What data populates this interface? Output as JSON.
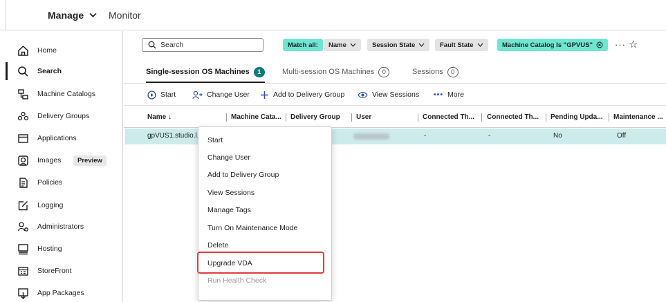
{
  "top_nav": {
    "manage": "Manage",
    "monitor": "Monitor"
  },
  "sidebar": {
    "items": [
      {
        "label": "Home",
        "icon": "home-icon"
      },
      {
        "label": "Search",
        "icon": "search-icon"
      },
      {
        "label": "Machine Catalogs",
        "icon": "machine-catalogs-icon"
      },
      {
        "label": "Delivery Groups",
        "icon": "delivery-groups-icon"
      },
      {
        "label": "Applications",
        "icon": "applications-icon"
      },
      {
        "label": "Images",
        "icon": "images-icon",
        "badge": "Preview"
      },
      {
        "label": "Policies",
        "icon": "policies-icon"
      },
      {
        "label": "Logging",
        "icon": "logging-icon"
      },
      {
        "label": "Administrators",
        "icon": "administrators-icon"
      },
      {
        "label": "Hosting",
        "icon": "hosting-icon"
      },
      {
        "label": "StoreFront",
        "icon": "storefront-icon"
      },
      {
        "label": "App Packages",
        "icon": "app-packages-icon"
      }
    ],
    "active": "Search"
  },
  "filters": {
    "search_placeholder": "Search",
    "match_all": "Match all:",
    "name": "Name",
    "session_state": "Session State",
    "fault_state": "Fault State",
    "machine_catalog": "Machine Catalog Is \"GPVUS\""
  },
  "tabs": [
    {
      "label": "Single-session OS Machines",
      "count": "1"
    },
    {
      "label": "Multi-session OS Machines",
      "count": "0"
    },
    {
      "label": "Sessions",
      "count": "0"
    }
  ],
  "actions": {
    "start": "Start",
    "change_user": "Change User",
    "add_to_delivery_group": "Add to Delivery Group",
    "view_sessions": "View Sessions",
    "more": "More"
  },
  "table": {
    "columns": [
      "Name ↓",
      "Machine Cata...",
      "Delivery Group",
      "User",
      "Connected Th...",
      "Connected Th...",
      "Pending Upda...",
      "Maintenance ..."
    ],
    "rows": [
      {
        "name": "gpVUS1.studio.l...",
        "connected_1": "-",
        "connected_2": "-",
        "pending_update": "No",
        "maintenance": "Off"
      }
    ]
  },
  "context_menu": {
    "items": [
      "Start",
      "Change User",
      "Add to Delivery Group",
      "View Sessions",
      "Manage Tags",
      "Turn On Maintenance Mode",
      "Delete",
      "Upgrade VDA",
      "Run Health Check"
    ],
    "highlighted": "Upgrade VDA",
    "disabled": "Run Health Check"
  },
  "colors": {
    "accent_teal": "#6ee6d2",
    "tab_badge": "#0e7b7b",
    "selected_row": "#cdebeb",
    "highlight_border": "#e03c3c"
  }
}
